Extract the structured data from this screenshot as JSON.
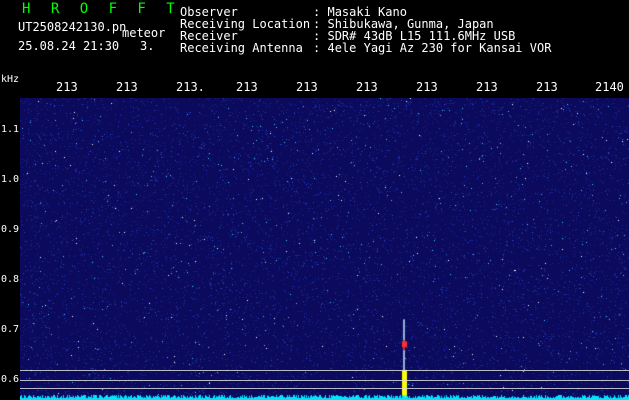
{
  "header": {
    "title": "H R O F F T",
    "filename": "UT2508242130.pn",
    "meteor_label": "meteor",
    "datetime": "25.08.24 21:30",
    "count": "3.",
    "rows": [
      {
        "label": "Observer",
        "sep": ":",
        "value": "Masaki Kano"
      },
      {
        "label": "Receiving Location",
        "sep": ":",
        "value": "Shibukawa, Gunma, Japan"
      },
      {
        "label": "Receiver",
        "sep": ":",
        "value": "SDR# 43dB L15 111.6MHz USB"
      },
      {
        "label": "Receiving Antenna",
        "sep": ":",
        "value": "4ele Yagi Az 230 for Kansai VOR"
      }
    ]
  },
  "time_axis": {
    "ticks": [
      "213",
      "213",
      "213.",
      "213",
      "213",
      "213",
      "213",
      "213",
      "213",
      "2140"
    ]
  },
  "freq_axis": {
    "unit": "kHz",
    "ticks": [
      "1.1",
      "1.0",
      "0.9",
      "0.8",
      "0.7",
      "0.6"
    ]
  },
  "colors": {
    "title": "#00ff00",
    "background": "#0b0a5c",
    "text": "#ffffff",
    "baseline": "#00e5ff"
  },
  "spectrogram": {
    "freq_range_khz": [
      0.56,
      1.16
    ],
    "events": [
      {
        "type": "meteor-echo",
        "time_fraction": 0.63,
        "freq_khz": [
          0.585,
          0.72
        ]
      }
    ]
  }
}
